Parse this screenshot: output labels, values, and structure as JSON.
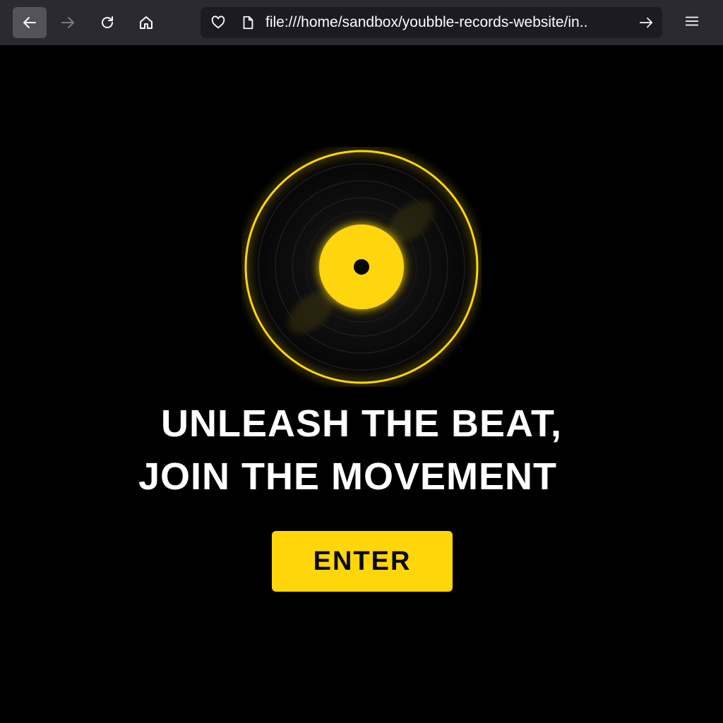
{
  "browser": {
    "url": "file:///home/sandbox/youbble-records-website/in..",
    "icons": {
      "back": "arrow-left-icon",
      "forward": "arrow-right-icon",
      "reload": "reload-icon",
      "home": "home-icon",
      "tracking": "shield-heart-icon",
      "page": "page-icon",
      "go": "arrow-right-icon",
      "menu": "hamburger-menu-icon"
    }
  },
  "hero": {
    "headline_line1": "UNLEASH THE BEAT,",
    "headline_line2": "JOIN THE MOVEMENT",
    "cta_label": "ENTER"
  },
  "colors": {
    "accent": "#ffd60a",
    "background": "#000000",
    "toolbar": "#2b2a33",
    "text": "#ffffff"
  }
}
